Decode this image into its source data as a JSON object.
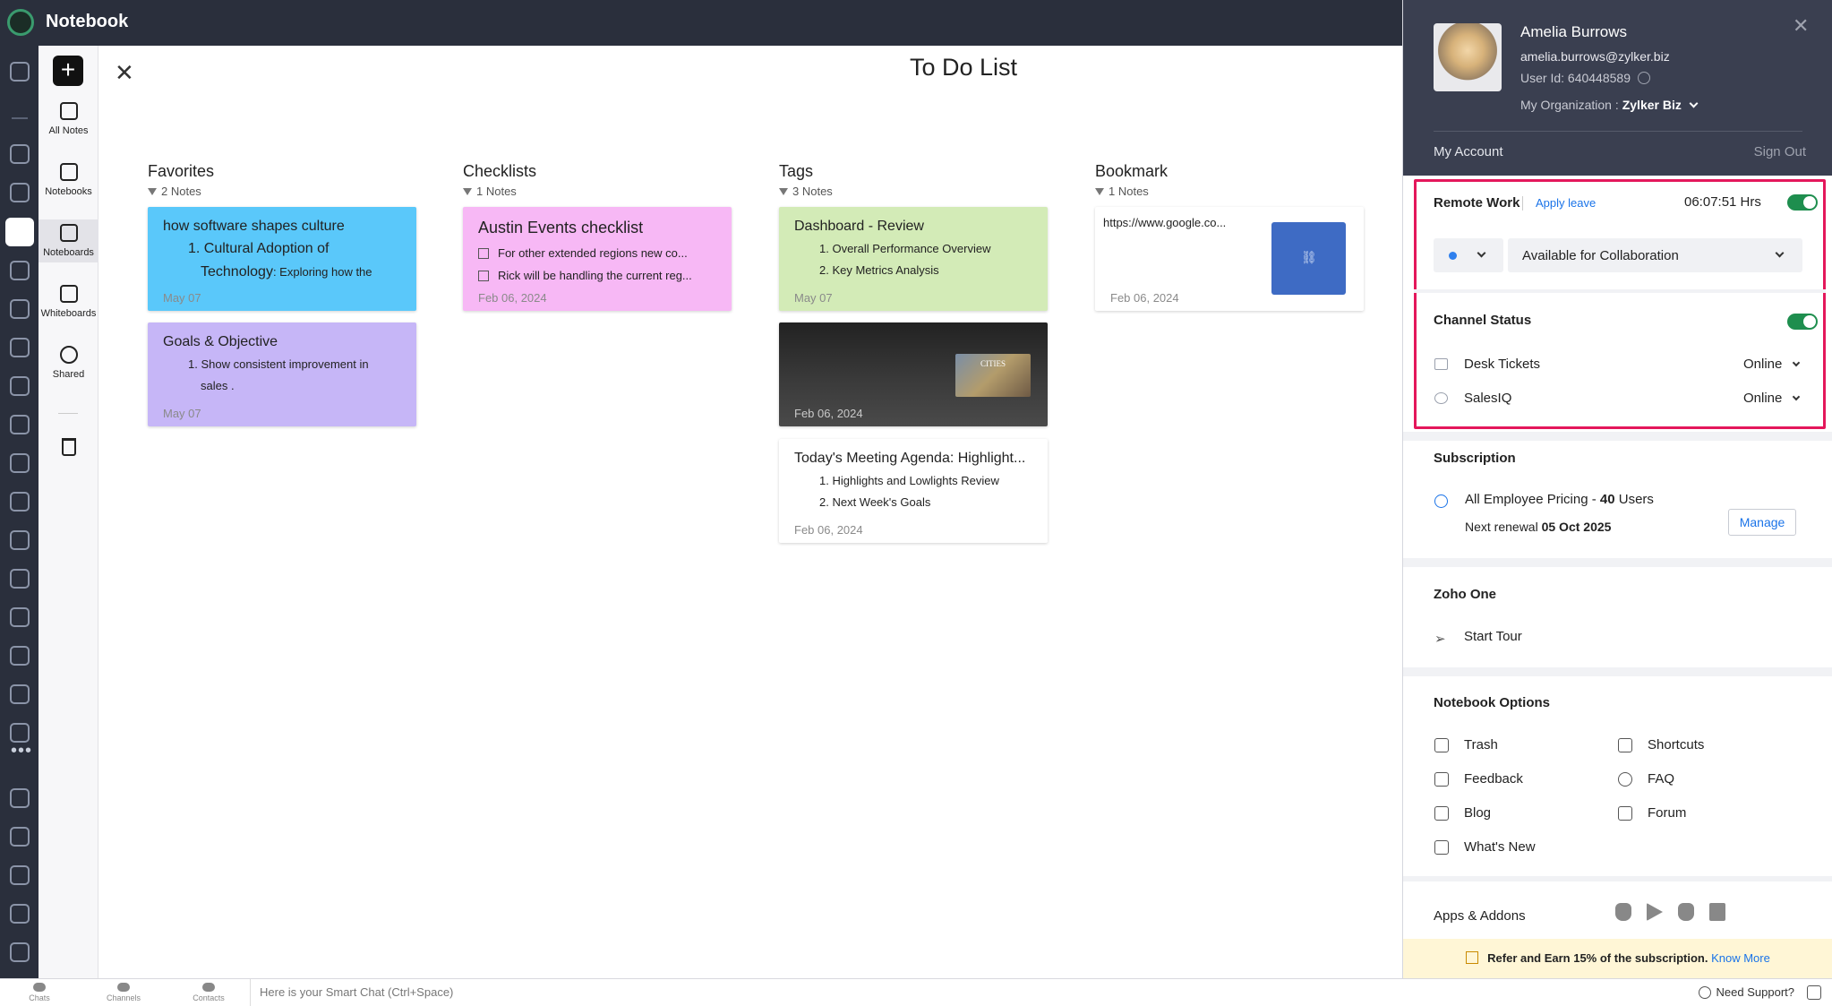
{
  "app": {
    "title": "Notebook"
  },
  "nav": {
    "items": [
      {
        "label": "All Notes"
      },
      {
        "label": "Notebooks"
      },
      {
        "label": "Noteboards"
      },
      {
        "label": "Whiteboards"
      },
      {
        "label": "Shared"
      }
    ]
  },
  "board": {
    "title": "To Do List",
    "columns": [
      {
        "title": "Favorites",
        "count": "2 Notes"
      },
      {
        "title": "Checklists",
        "count": "1 Notes"
      },
      {
        "title": "Tags",
        "count": "3 Notes"
      },
      {
        "title": "Bookmark",
        "count": "1 Notes"
      }
    ],
    "cards": {
      "fav1": {
        "title": "how software shapes culture",
        "line1": "1. Cultural Adoption of",
        "line2a": "Technology",
        "line2b": ": Exploring how the",
        "date": "May 07"
      },
      "fav2": {
        "title": "Goals & Objective",
        "line1": "1. Show consistent improvement in",
        "line2": "sales .",
        "date": "May 07"
      },
      "chk1": {
        "title": "Austin Events checklist",
        "item1": "For other extended regions new co...",
        "item2": "Rick will be handling the current reg...",
        "date": "Feb 06, 2024"
      },
      "tag1": {
        "title": "Dashboard - Review",
        "line1": "1. Overall Performance Overview",
        "line2": "2. Key Metrics Analysis",
        "date": "May 07"
      },
      "tag2": {
        "image_text": "CITIES",
        "date": "Feb 06, 2024"
      },
      "tag3": {
        "title": "Today's Meeting Agenda: Highlight...",
        "line1": "1. Highlights and Lowlights Review",
        "line2": "2. Next Week's Goals",
        "date": "Feb 06, 2024"
      },
      "bm1": {
        "url": "https://www.google.co...",
        "date": "Feb 06, 2024"
      }
    }
  },
  "profile": {
    "name": "Amelia Burrows",
    "email": "amelia.burrows@zylker.biz",
    "user_id": "User Id: 640448589",
    "org_label": "My Organization :",
    "org_name": "Zylker Biz",
    "my_account": "My Account",
    "sign_out": "Sign Out"
  },
  "remote": {
    "label": "Remote Work",
    "apply_leave": "Apply leave",
    "timer": "06:07:51 Hrs",
    "status": "Available for Collaboration"
  },
  "channel": {
    "label": "Channel Status",
    "rows": [
      {
        "name": "Desk Tickets",
        "status": "Online"
      },
      {
        "name": "SalesIQ",
        "status": "Online"
      }
    ]
  },
  "subscription": {
    "label": "Subscription",
    "plan": "All Employee Pricing - ",
    "users_num": "40",
    "users_word": " Users",
    "renewal_label": "Next renewal ",
    "renewal_date": "05 Oct 2025",
    "manage": "Manage"
  },
  "zoho_one": {
    "label": "Zoho One",
    "start_tour": "Start Tour"
  },
  "options": {
    "label": "Notebook Options",
    "items": [
      "Trash",
      "Shortcuts",
      "Feedback",
      "FAQ",
      "Blog",
      "Forum",
      "What's New"
    ]
  },
  "apps": {
    "label": "Apps & Addons",
    "platforms": [
      "apple-icon",
      "google-play-icon",
      "apple-icon",
      "windows-icon"
    ]
  },
  "refer": {
    "text": "Refer and Earn 15% of the subscription.",
    "link": "Know More"
  },
  "bottom": {
    "tabs": [
      "Chats",
      "Channels",
      "Contacts"
    ],
    "chat_placeholder": "Here is your Smart Chat (Ctrl+Space)",
    "support": "Need Support?"
  },
  "colors": {
    "favorites": "#5ac8fa",
    "goals": "#c6b6f7",
    "checklist": "#f7b8f5",
    "tags": "#d3ebb7",
    "highlight": "#e4175b",
    "toggle": "#1e8e4e"
  }
}
